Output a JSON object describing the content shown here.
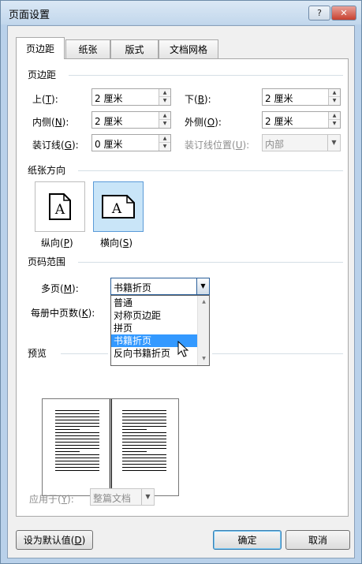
{
  "window": {
    "title": "页面设置",
    "help_label": "?",
    "close_label": "✕"
  },
  "tabs": [
    {
      "label": "页边距",
      "active": true
    },
    {
      "label": "纸张",
      "active": false
    },
    {
      "label": "版式",
      "active": false
    },
    {
      "label": "文档网格",
      "active": false
    }
  ],
  "margins": {
    "section_title": "页边距",
    "top": {
      "label": "上(T):",
      "key": "T",
      "value": "2 厘米"
    },
    "bottom": {
      "label": "下(B):",
      "key": "B",
      "value": "2 厘米"
    },
    "inside": {
      "label": "内侧(N):",
      "key": "N",
      "value": "2 厘米"
    },
    "outside": {
      "label": "外侧(O):",
      "key": "O",
      "value": "2 厘米"
    },
    "gutter": {
      "label": "装订线(G):",
      "key": "G",
      "value": "0 厘米"
    },
    "gutter_position": {
      "label": "装订线位置(U):",
      "key": "U",
      "value": "内部"
    }
  },
  "orientation": {
    "section_title": "纸张方向",
    "portrait": {
      "label": "纵向(P)",
      "key": "P",
      "glyph": "A",
      "selected": false
    },
    "landscape": {
      "label": "横向(S)",
      "key": "S",
      "glyph": "A",
      "selected": true
    }
  },
  "pages": {
    "section_title": "页码范围",
    "multiple_label": "多页(M):",
    "multiple_key": "M",
    "multiple_value": "书籍折页",
    "sheets_label": "每册中页数(K):",
    "sheets_key": "K",
    "options": [
      "普通",
      "对称页边距",
      "拼页",
      "书籍折页",
      "反向书籍折页"
    ],
    "highlighted_index": 3
  },
  "preview": {
    "section_title": "预览"
  },
  "apply_to": {
    "label": "应用于(Y):",
    "key": "Y",
    "value": "整篇文档"
  },
  "buttons": {
    "set_default": "设为默认值(D)",
    "set_default_key": "D",
    "ok": "确定",
    "cancel": "取消"
  },
  "colors": {
    "accent": "#3399ff",
    "selected_bg": "#c9e5f8",
    "close": "#c7402f"
  },
  "icons": {
    "help": "help-icon",
    "close": "close-icon",
    "spin": "spin-arrows-icon",
    "dropdown": "chevron-down-icon",
    "cursor": "mouse-pointer-icon"
  }
}
